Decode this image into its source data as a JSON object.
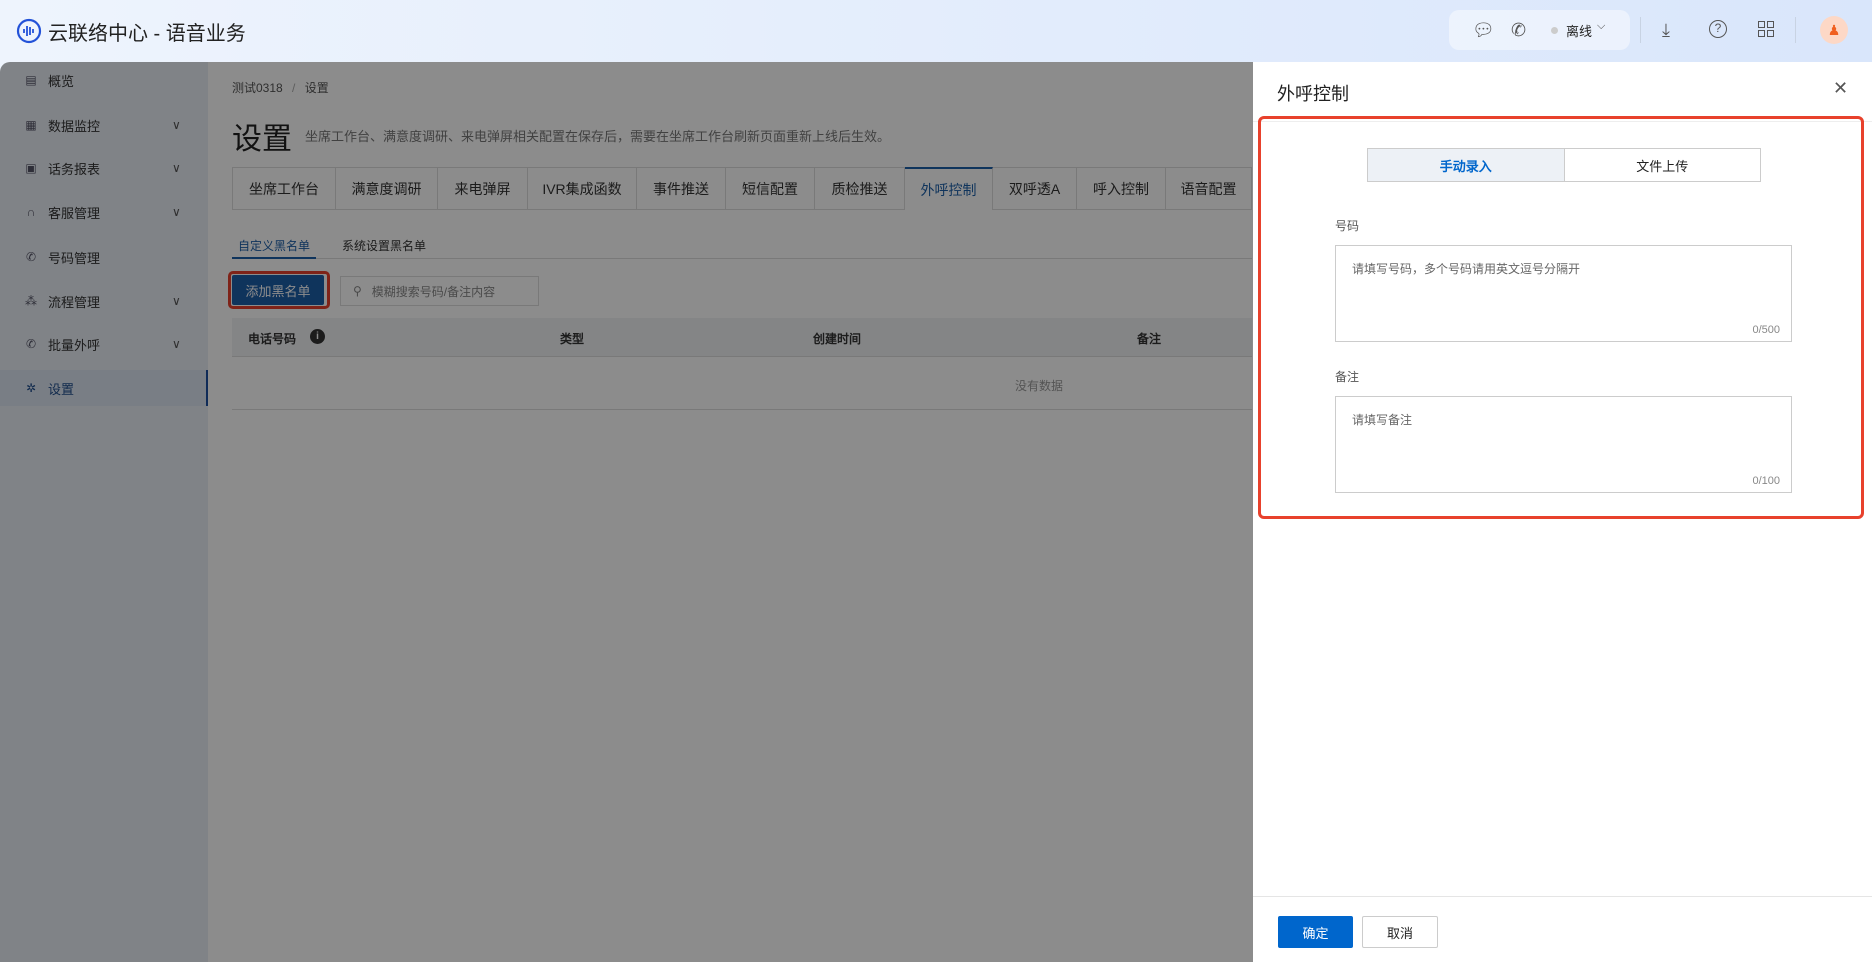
{
  "app": {
    "title": "云联络中心 - 语音业务"
  },
  "topbar": {
    "status": "离线",
    "icons": [
      "chat-icon",
      "phone-icon",
      "download-icon",
      "help-icon",
      "grid-icon",
      "avatar"
    ]
  },
  "sidebar": {
    "items": [
      {
        "label": "概览",
        "icon": "overview-icon",
        "chevron": false
      },
      {
        "label": "数据监控",
        "icon": "monitor-icon",
        "chevron": true
      },
      {
        "label": "话务报表",
        "icon": "report-icon",
        "chevron": true
      },
      {
        "label": "客服管理",
        "icon": "headset-icon",
        "chevron": true
      },
      {
        "label": "号码管理",
        "icon": "phone-icon",
        "chevron": false
      },
      {
        "label": "流程管理",
        "icon": "flow-icon",
        "chevron": true
      },
      {
        "label": "批量外呼",
        "icon": "outbound-icon",
        "chevron": true
      },
      {
        "label": "设置",
        "icon": "gear-icon",
        "chevron": false,
        "active": true
      }
    ]
  },
  "breadcrumb": {
    "parent": "测试0318",
    "sep": "/",
    "current": "设置"
  },
  "page": {
    "title": "设置",
    "description": "坐席工作台、满意度调研、来电弹屏相关配置在保存后，需要在坐席工作台刷新页面重新上线后生效。"
  },
  "tabs": [
    "坐席工作台",
    "满意度调研",
    "来电弹屏",
    "IVR集成函数",
    "事件推送",
    "短信配置",
    "质检推送",
    "外呼控制",
    "双呼透A",
    "呼入控制",
    "语音配置"
  ],
  "active_tab": "外呼控制",
  "subtabs": [
    "自定义黑名单",
    "系统设置黑名单"
  ],
  "toolbar": {
    "add_button": "添加黑名单",
    "search_placeholder": "模糊搜索号码/备注内容"
  },
  "table": {
    "columns": [
      "电话号码",
      "类型",
      "创建时间",
      "备注"
    ],
    "empty": "没有数据"
  },
  "drawer": {
    "title": "外呼控制",
    "segments": [
      "手动录入",
      "文件上传"
    ],
    "number_label": "号码",
    "number_placeholder": "请填写号码，多个号码请用英文逗号分隔开",
    "number_count": "0/500",
    "note_label": "备注",
    "note_placeholder": "请填写备注",
    "note_count": "0/100",
    "confirm": "确定",
    "cancel": "取消"
  },
  "colors": {
    "accent": "#0066cc",
    "highlight": "#e8412c"
  }
}
